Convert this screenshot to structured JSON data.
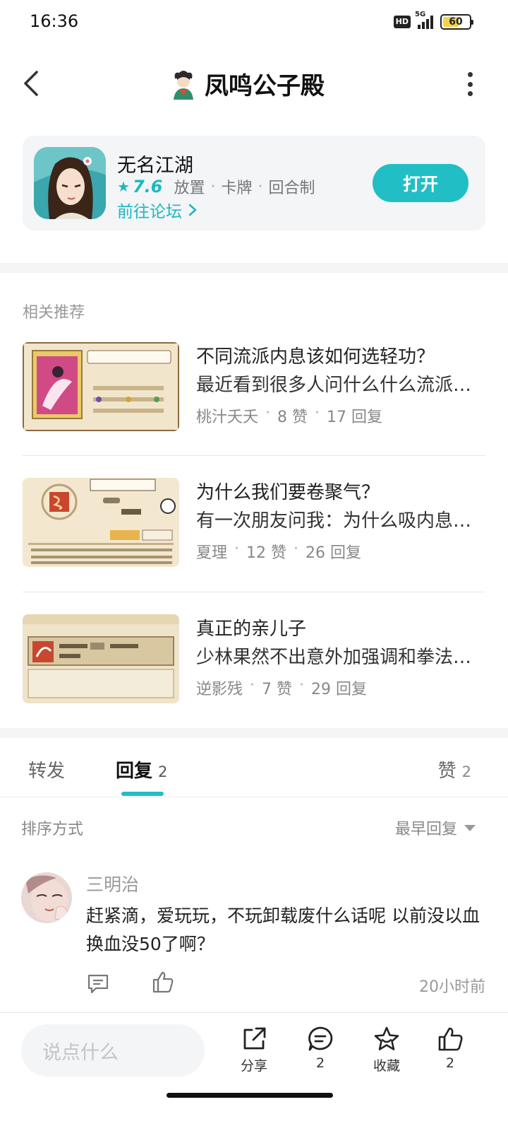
{
  "status_bar": {
    "time": "16:36",
    "hd": "HD",
    "network": "5G",
    "battery": "60"
  },
  "header": {
    "title": "凤鸣公子殿"
  },
  "game_card": {
    "name": "无名江湖",
    "score": "7.6",
    "tags": [
      "放置",
      "卡牌",
      "回合制"
    ],
    "forum_link": "前往论坛",
    "open_label": "打开"
  },
  "recommend": {
    "label": "相关推荐",
    "items": [
      {
        "title": "不同流派内息该如何选轻功？",
        "excerpt": "最近看到很多人问什么什么流派该选什么轻功",
        "author": "桃汁夭夭",
        "likes": "8 赞",
        "replies": "17 回复"
      },
      {
        "title": "为什么我们要卷聚气？",
        "excerpt": "有一次朋友问我：为什么吸内息要卷聚气",
        "author": "夏理",
        "likes": "12 赞",
        "replies": "26 回复"
      },
      {
        "title": "真正的亲儿子",
        "excerpt": "少林果然不出意外加强调和拳法的效果",
        "author": "逆影残",
        "likes": "7 赞",
        "replies": "29 回复"
      }
    ]
  },
  "tabs": {
    "forward": "转发",
    "reply": "回复",
    "reply_count": "2",
    "like": "赞",
    "like_count": "2"
  },
  "sort": {
    "label": "排序方式",
    "value": "最早回复"
  },
  "comments": [
    {
      "user": "三明治",
      "text": "赶紧滴，爱玩玩，不玩卸载废什么话呢 以前没以血换血没50了啊？",
      "time": "20小时前"
    }
  ],
  "bottom_bar": {
    "input_placeholder": "说点什么",
    "share": "分享",
    "comment_count": "2",
    "favorite": "收藏",
    "like_count": "2"
  },
  "colors": {
    "accent": "#22bec6",
    "accent_text": "#1bb9bd"
  }
}
